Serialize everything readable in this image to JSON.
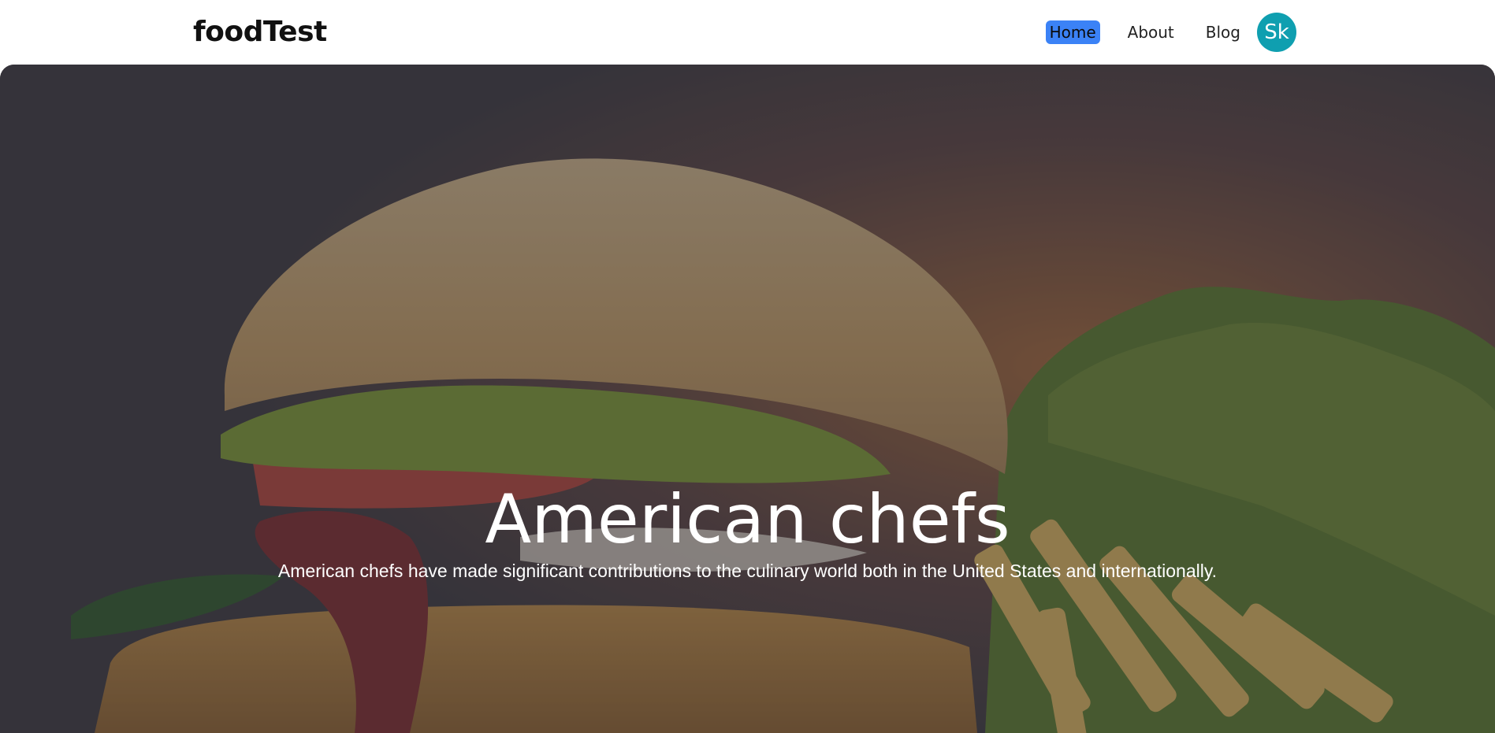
{
  "brand": {
    "name": "foodTest"
  },
  "nav": {
    "items": [
      {
        "label": "Home",
        "active": true
      },
      {
        "label": "About",
        "active": false
      },
      {
        "label": "Blog",
        "active": false
      }
    ],
    "avatar_initials": "Sk"
  },
  "hero": {
    "title": "American chefs",
    "subtitle": "American chefs have made significant contributions to the culinary world both in the United States and internationally.",
    "image_subject": "burger-with-lettuce-and-fries"
  },
  "colors": {
    "active_nav_bg": "#3b82f6",
    "avatar_bg": "#0f9fb0",
    "hero_overlay": "#2e2c35"
  }
}
